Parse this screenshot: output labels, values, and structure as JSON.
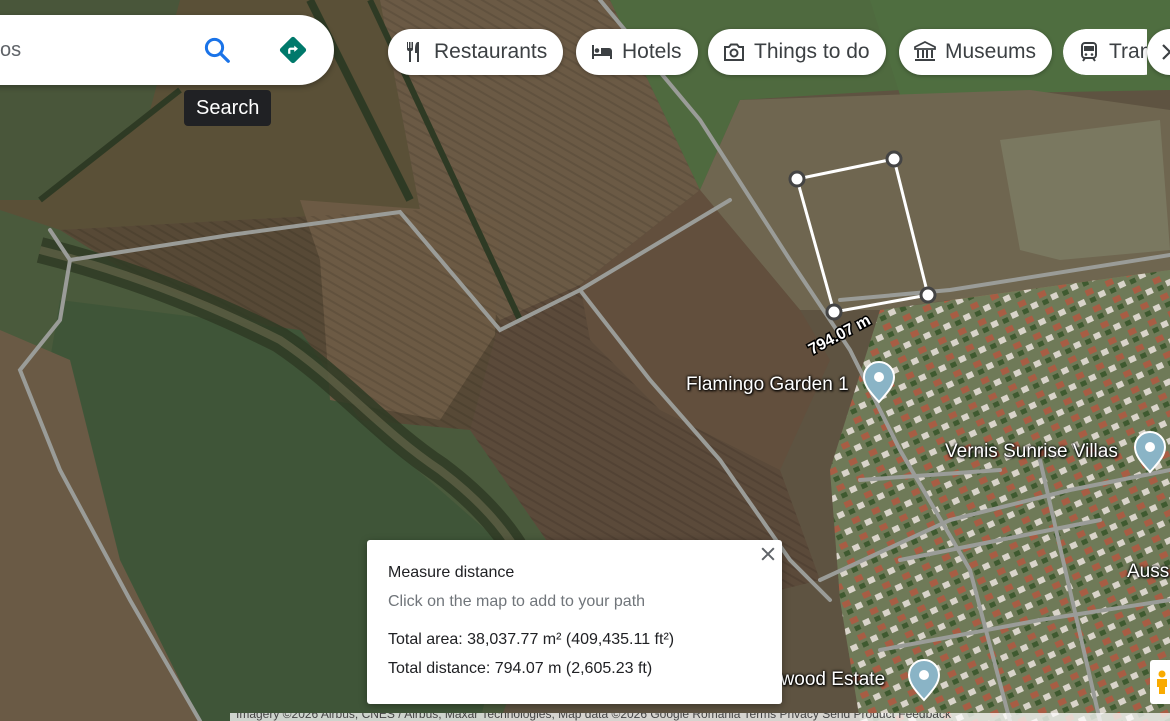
{
  "search": {
    "query_fragment": "os",
    "tooltip": "Search"
  },
  "categories": [
    {
      "label": "Restaurants",
      "icon": "fork-knife-icon"
    },
    {
      "label": "Hotels",
      "icon": "bed-icon"
    },
    {
      "label": "Things to do",
      "icon": "camera-icon"
    },
    {
      "label": "Museums",
      "icon": "museum-icon"
    },
    {
      "label": "Tran",
      "icon": "train-icon"
    }
  ],
  "map": {
    "measurement_label": "794.07 m",
    "places": {
      "flamingo": "Flamingo Garden 1",
      "vernis": "Vernis Sunrise Villas",
      "auss": "Auss",
      "woodestate": "nwood Estate"
    }
  },
  "measure_panel": {
    "title": "Measure distance",
    "hint": "Click on the map to add to your path",
    "total_area": "Total area: 38,037.77 m² (409,435.11 ft²)",
    "total_distance": "Total distance: 794.07 m (2,605.23 ft)"
  },
  "attribution": "Imagery ©2026 Airbus, CNES / Airbus, Maxar Technologies, Map data ©2026 Google   Romania   Terms   Privacy   Send Product Feedback",
  "colors": {
    "accent": "#1a73e8",
    "directions": "#00796b",
    "pin": "#8ab4c6"
  }
}
